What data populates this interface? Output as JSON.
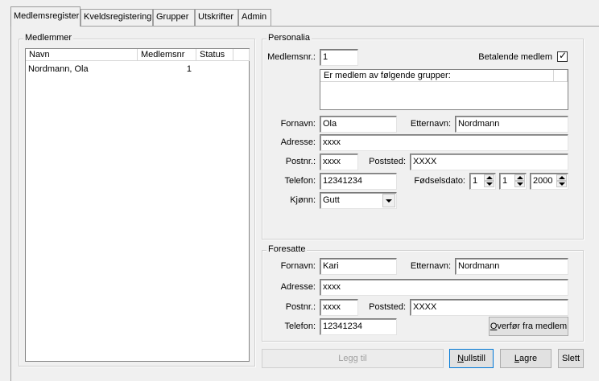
{
  "tabs": [
    {
      "label": "Medlemsregister"
    },
    {
      "label": "Kveldsregistering"
    },
    {
      "label": "Grupper"
    },
    {
      "label": "Utskrifter"
    },
    {
      "label": "Admin"
    }
  ],
  "members": {
    "title": "Medlemmer",
    "columns": [
      "Navn",
      "Medlemsnr",
      "Status"
    ],
    "rows": [
      {
        "name": "Nordmann, Ola",
        "number": "1",
        "status": ""
      }
    ]
  },
  "personalia": {
    "title": "Personalia",
    "member_number_label": "Medlemsnr.:",
    "member_number": "1",
    "paying_member_label": "Betalende medlem",
    "paying_member_checked": "✓",
    "groups_header": "Er medlem av følgende grupper:",
    "first_name_label": "Fornavn:",
    "first_name": "Ola",
    "last_name_label": "Etternavn:",
    "last_name": "Nordmann",
    "address_label": "Adresse:",
    "address": "xxxx",
    "postcode_label": "Postnr.:",
    "postcode": "xxxx",
    "city_label": "Poststed:",
    "city": "XXXX",
    "phone_label": "Telefon:",
    "phone": "12341234",
    "birthdate_label": "Fødselsdato:",
    "birth_day": "1",
    "birth_month": "1",
    "birth_year": "2000",
    "gender_label": "Kjønn:",
    "gender": "Gutt"
  },
  "guardian": {
    "title": "Foresatte",
    "first_name_label": "Fornavn:",
    "first_name": "Kari",
    "last_name_label": "Etternavn:",
    "last_name": "Nordmann",
    "address_label": "Adresse:",
    "address": "xxxx",
    "postcode_label": "Postnr.:",
    "postcode": "xxxx",
    "city_label": "Poststed:",
    "city": "XXXX",
    "phone_label": "Telefon:",
    "phone": "12341234",
    "transfer_button_first": "O",
    "transfer_button_rest": "verfør fra medlem"
  },
  "actions": {
    "add": "Legg til",
    "reset_first": "N",
    "reset_rest": "ullstill",
    "save_first": "L",
    "save_rest": "agre",
    "delete": "Slett"
  }
}
